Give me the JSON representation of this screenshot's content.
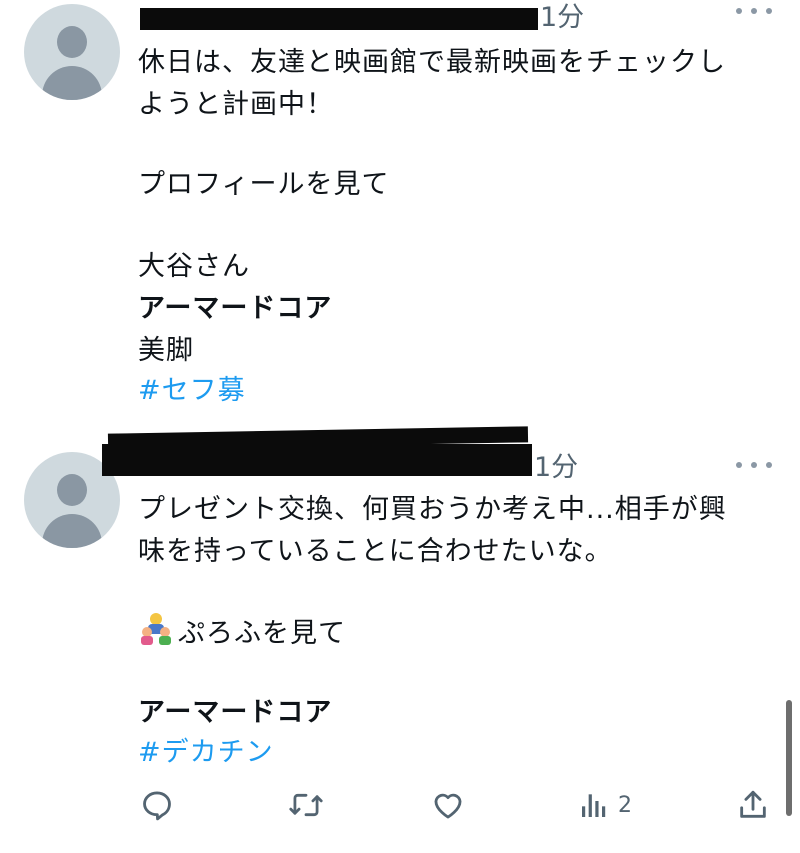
{
  "tweets": [
    {
      "time": "1分",
      "lines": [
        "休日は、友達と映画館で最新映画をチェックし",
        "ようと計画中！",
        "プロフィールを見て",
        "大谷さん",
        "アーマードコア",
        "美脚",
        "#セフ募"
      ]
    },
    {
      "time": "1分",
      "lines": [
        "プレゼント交換、何買おうか考え中...相手が興",
        "味を持っていることに合わせたいな。",
        "ぷろふを見て",
        "アーマードコア",
        "#デカチン"
      ],
      "emoji": "family-emoji"
    }
  ],
  "actions": {
    "reply_icon": "reply-icon",
    "retweet_icon": "retweet-icon",
    "like_icon": "like-icon",
    "views_icon": "views-icon",
    "views_count": "2",
    "share_icon": "share-icon"
  },
  "colors": {
    "text": "#0f1419",
    "secondary": "#536471",
    "hashtag": "#1d9bf0",
    "avatar_bg": "#cfd9de",
    "avatar_fg": "#8a97a3"
  }
}
